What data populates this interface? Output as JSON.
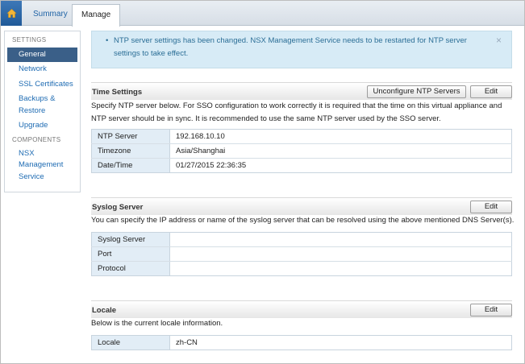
{
  "tabs": {
    "summary": "Summary",
    "manage": "Manage"
  },
  "sidebar": {
    "settings_heading": "SETTINGS",
    "settings_items": [
      "General",
      "Network",
      "SSL Certificates",
      "Backups & Restore",
      "Upgrade"
    ],
    "components_heading": "COMPONENTS",
    "components_items": [
      "NSX Management Service"
    ]
  },
  "alert": {
    "message": "NTP server settings has been changed. NSX Management Service needs to be restarted for NTP server settings to take effect.",
    "close_symbol": "×"
  },
  "time_settings": {
    "title": "Time Settings",
    "unconfigure_button": "Unconfigure NTP Servers",
    "edit_button": "Edit",
    "description": "Specify NTP server below. For SSO configuration to work correctly it is required that the time on this virtual appliance and NTP server should be in sync. It is recommended to use the same NTP server used by the SSO server.",
    "rows": [
      {
        "label": "NTP Server",
        "value": "192.168.10.10"
      },
      {
        "label": "Timezone",
        "value": "Asia/Shanghai"
      },
      {
        "label": "Date/Time",
        "value": "01/27/2015 22:36:35"
      }
    ]
  },
  "syslog": {
    "title": "Syslog Server",
    "edit_button": "Edit",
    "description": "You can specify the IP address or name of the syslog server that can be resolved using the above mentioned DNS Server(s).",
    "rows": [
      {
        "label": "Syslog Server",
        "value": ""
      },
      {
        "label": "Port",
        "value": ""
      },
      {
        "label": "Protocol",
        "value": ""
      }
    ]
  },
  "locale": {
    "title": "Locale",
    "edit_button": "Edit",
    "description": "Below is the current locale information.",
    "rows": [
      {
        "label": "Locale",
        "value": "zh-CN"
      }
    ]
  },
  "colors": {
    "accent": "#1f6cb3",
    "active_nav": "#3a5f88",
    "alert_bg": "#d7ebf6",
    "key_cell_bg": "#e2edf6"
  },
  "icons": {
    "home": "home-icon"
  }
}
